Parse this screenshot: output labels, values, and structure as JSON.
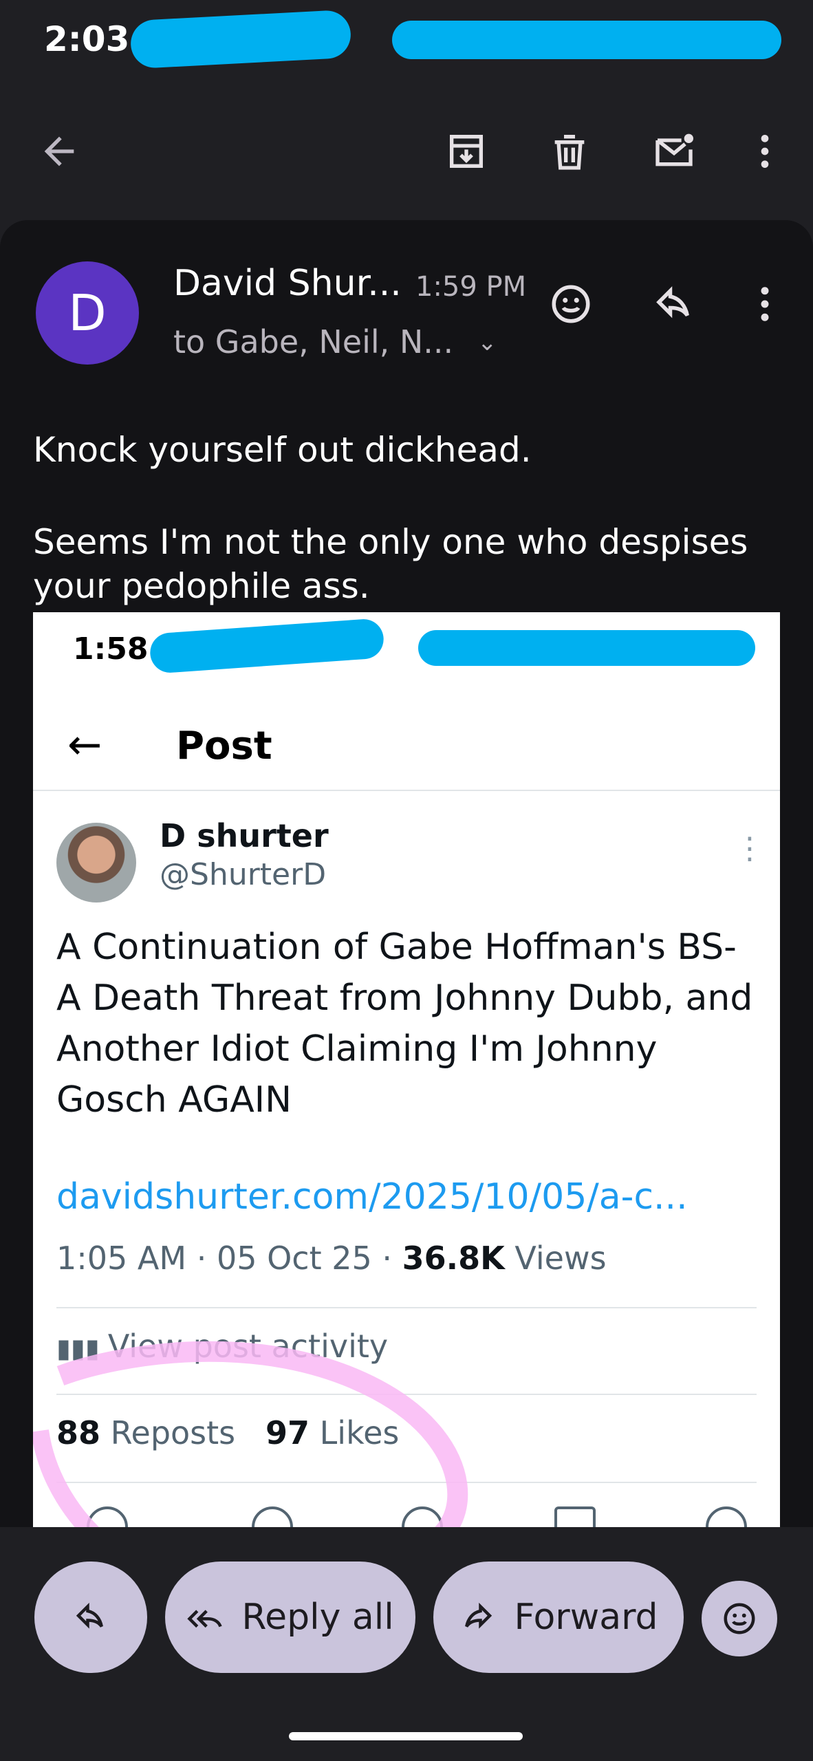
{
  "status_bar": {
    "time": "2:03"
  },
  "toolbar": {
    "back_icon": "arrow-back-icon",
    "archive_icon": "archive-icon",
    "delete_icon": "trash-icon",
    "mark_unread_icon": "mail-unread-icon",
    "more_icon": "more-vert-icon"
  },
  "email": {
    "avatar_letter": "D",
    "sender": "David Shur...",
    "time": "1:59 PM",
    "recipients": "to Gabe, Neil, N...",
    "body_line1": "Knock yourself out dickhead.",
    "body_line2": "Seems I'm not the only one who despises",
    "body_line3": "your pedophile ass."
  },
  "embedded_screenshot": {
    "status_time": "1:58",
    "header_title": "Post",
    "author_name": "D shurter",
    "author_handle": "@ShurterD",
    "post_text": "A Continuation of Gabe Hoffman's BS- A Death Threat from Johnny Dubb, and Another Idiot Claiming I'm Johnny Gosch AGAIN",
    "link": "davidshurter.com/2025/10/05/a-c...",
    "meta_time": "1:05 AM · 05 Oct 25 · ",
    "views_count": "36.8K",
    "views_label": " Views",
    "activity_label": "View post activity",
    "reposts_count": "88",
    "reposts_label": " Reposts",
    "likes_count": "97",
    "likes_label": " Likes"
  },
  "actions": {
    "reply_icon": "reply-icon",
    "reply_all_label": "Reply all",
    "forward_label": "Forward",
    "emoji_icon": "emoji-icon"
  },
  "colors": {
    "background": "#1f1f23",
    "card": "#131316",
    "avatar": "#5b34c2",
    "pill": "#cac4dc",
    "link": "#1d9bf0",
    "redaction": "#00b0f0",
    "circle_annotation": "#f9b8f5"
  }
}
